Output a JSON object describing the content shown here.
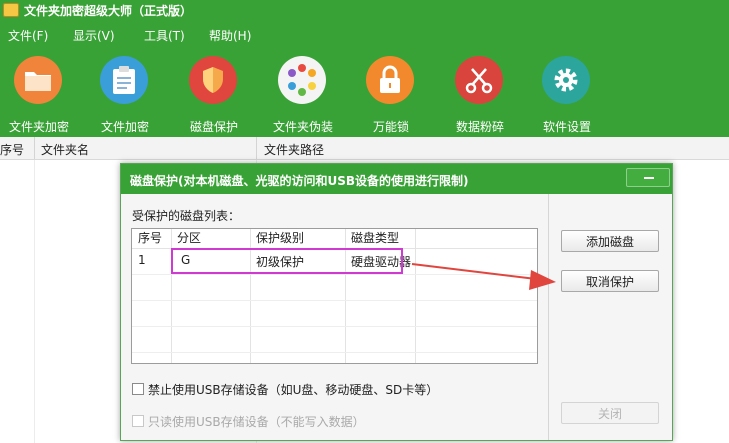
{
  "app": {
    "title": "文件夹加密超级大师（正式版）"
  },
  "menu": [
    {
      "label": "文件(F)"
    },
    {
      "label": "显示(V)"
    },
    {
      "label": "工具(T)"
    },
    {
      "label": "帮助(H)"
    }
  ],
  "toolbar": [
    {
      "label": "文件夹加密",
      "icon": "folder-icon",
      "color": "#f0843a"
    },
    {
      "label": "文件加密",
      "icon": "clipboard-icon",
      "color": "#3a9ed9"
    },
    {
      "label": "磁盘保护",
      "icon": "shield-icon",
      "color": "#e0453e"
    },
    {
      "label": "文件夹伪装",
      "icon": "color-wheel-icon",
      "color": "#f4f4f4"
    },
    {
      "label": "万能锁",
      "icon": "padlock-icon",
      "color": "#f28a2d"
    },
    {
      "label": "数据粉碎",
      "icon": "scissors-icon",
      "color": "#d9453c"
    },
    {
      "label": "软件设置",
      "icon": "gear-icon",
      "color": "#2ca59c"
    }
  ],
  "list": {
    "columns": [
      "序号",
      "文件夹名",
      "文件夹路径"
    ]
  },
  "dialog": {
    "title": "磁盘保护(对本机磁盘、光驱的访问和USB设备的使用进行限制)",
    "list_label": "受保护的磁盘列表：",
    "columns": [
      "序号",
      "分区",
      "保护级别",
      "磁盘类型"
    ],
    "rows": [
      {
        "index": "1",
        "partition": "G",
        "level": "初级保护",
        "type": "硬盘驱动器"
      }
    ],
    "buttons": {
      "add": "添加磁盘",
      "cancel_protect": "取消保护",
      "close": "关闭"
    },
    "options": {
      "disable_usb": "禁止使用USB存储设备（如U盘、移动硬盘、SD卡等）",
      "readonly_usb": "只读使用USB存储设备（不能写入数据）"
    },
    "highlight_color": "#cf3bd2",
    "arrow_color": "#e0453e"
  }
}
